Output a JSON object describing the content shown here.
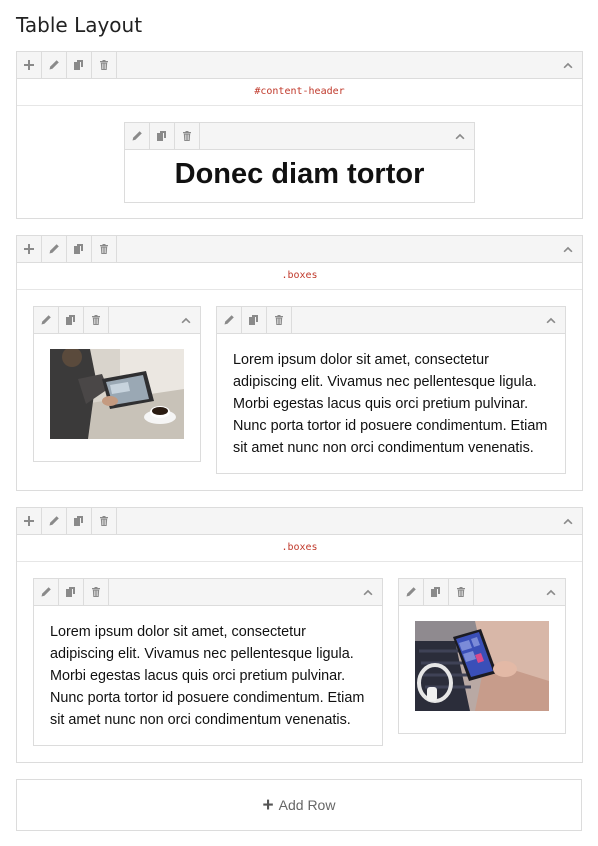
{
  "page": {
    "title": "Table Layout"
  },
  "rows": [
    {
      "selector": "#content-header",
      "blocks": [
        {
          "type": "heading",
          "text": "Donec diam tortor"
        }
      ]
    },
    {
      "selector": ".boxes",
      "blocks": [
        {
          "type": "image",
          "image": "person using tablet with coffee cup"
        },
        {
          "type": "text",
          "lines": [
            "Lorem ipsum dolor sit amet, consectetur",
            "adipiscing elit. Vivamus nec pellentesque ligula.",
            "Morbi egestas lacus quis orci pretium pulvinar.",
            "Nunc porta tortor id posuere condimentum. Etiam",
            "sit amet nunc non orci condimentum venenatis."
          ]
        }
      ]
    },
    {
      "selector": ".boxes",
      "blocks": [
        {
          "type": "text",
          "lines": [
            "Lorem ipsum dolor sit amet, consectetur",
            "adipiscing elit. Vivamus nec pellentesque ligula.",
            "Morbi egestas lacus quis orci pretium pulvinar.",
            "Nunc porta tortor id posuere condimentum. Etiam",
            "sit amet nunc non orci condimentum venenatis."
          ]
        },
        {
          "type": "image",
          "image": "person holding smartphone with headphones"
        }
      ]
    }
  ],
  "add_row": {
    "icon": "plus-icon",
    "label": "Add Row"
  },
  "icons": {
    "add": "plus-icon",
    "edit": "pencil-icon",
    "duplicate": "copy-icon",
    "delete": "trash-icon",
    "collapse": "chevron-up-icon"
  },
  "colors": {
    "selector_text": "#c0392b",
    "border": "#dcdcdc",
    "toolbar_bg": "#f5f5f5",
    "icon": "#8a8a8a"
  }
}
